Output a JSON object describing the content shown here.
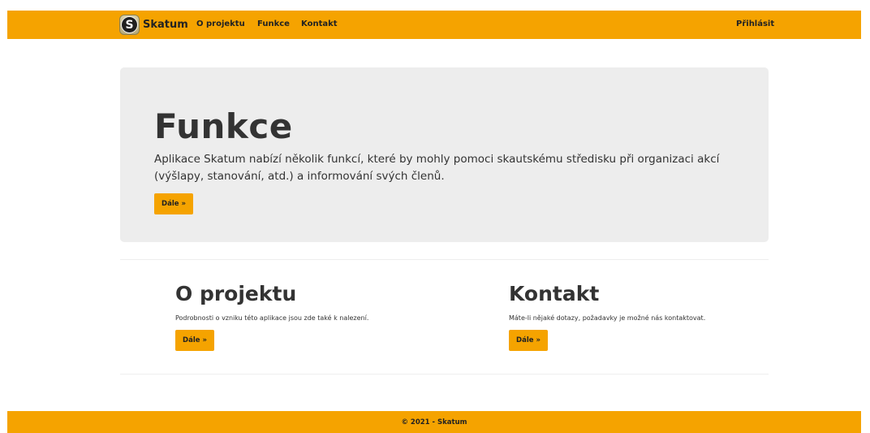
{
  "theme": {
    "accent": "#f5a300",
    "jumbotron_bg": "#ededed"
  },
  "navbar": {
    "logo_letter": "S",
    "brand": "Skatum",
    "links": [
      {
        "label": "O projektu"
      },
      {
        "label": "Funkce"
      },
      {
        "label": "Kontakt"
      }
    ],
    "login_label": "Přihlásit"
  },
  "jumbotron": {
    "title": "Funkce",
    "lead": "Aplikace Skatum nabízí několik funkcí, které by mohly pomoci skautskému středisku při organizaci akcí (výšlapy, stanování, atd.) a informování svých členů.",
    "button_label": "Dále »"
  },
  "columns": [
    {
      "title": "O projektu",
      "text": "Podrobnosti o vzniku této aplikace jsou zde také k nalezení.",
      "button_label": "Dále »"
    },
    {
      "title": "Kontakt",
      "text": "Máte-li nějaké dotazy, požadavky je možné nás kontaktovat.",
      "button_label": "Dále »"
    }
  ],
  "footer": {
    "text": "© 2021 - Skatum"
  }
}
